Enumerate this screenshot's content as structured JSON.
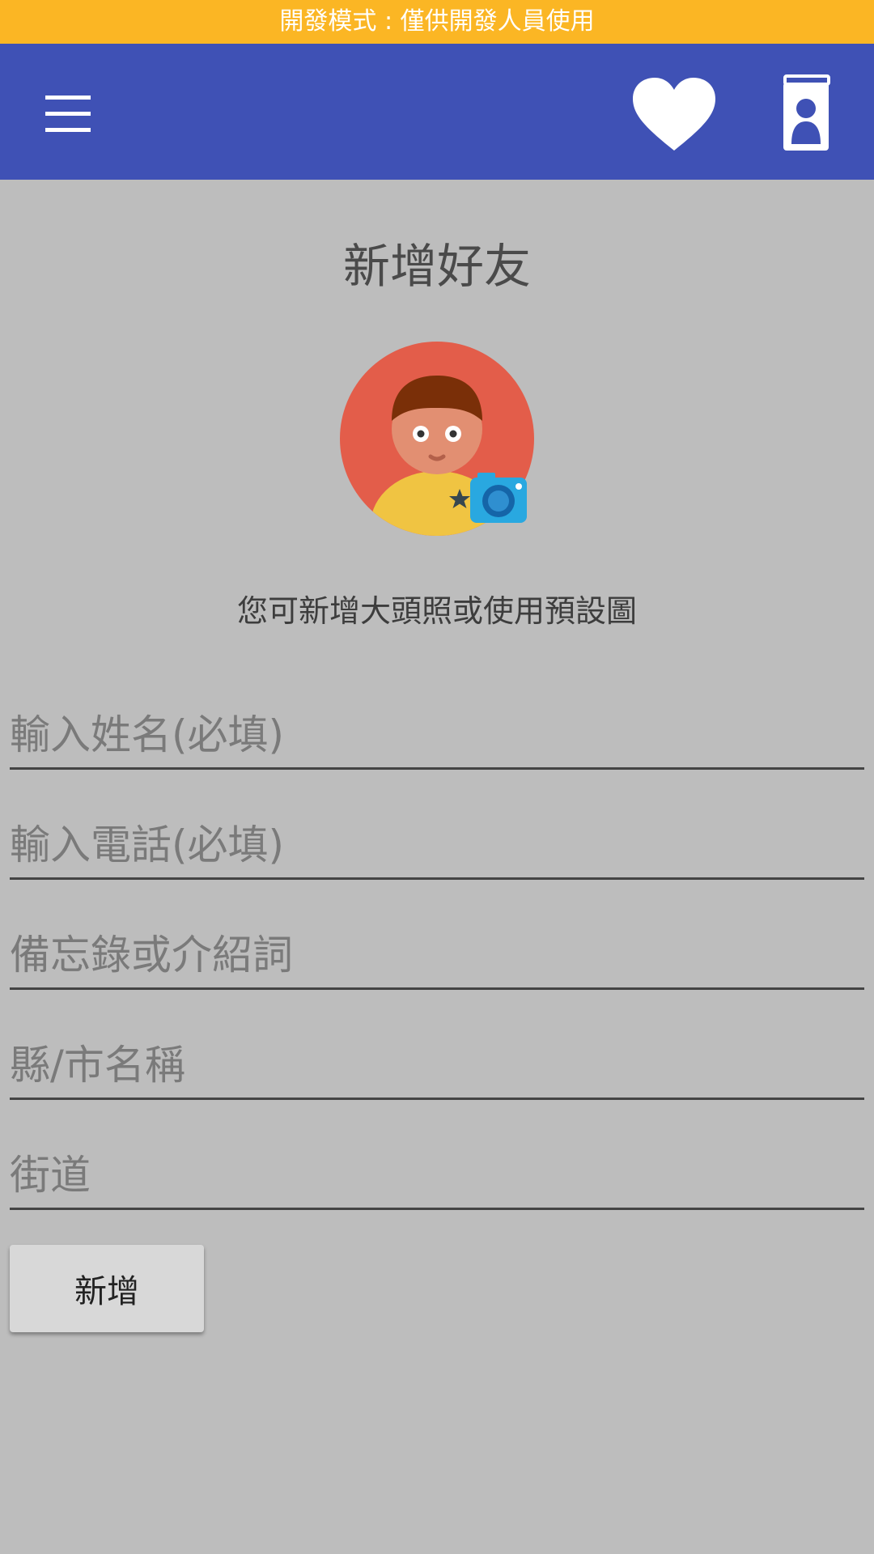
{
  "dev_banner": "開發模式 : 僅供開發人員使用",
  "app_bar": {
    "color": "#3f51b5",
    "icons": [
      "menu-icon",
      "heart-icon",
      "contacts-book-icon"
    ]
  },
  "form": {
    "title": "新增好友",
    "avatar_icon": "default-avatar-with-camera-icon",
    "avatar_hint": "您可新增大頭照或使用預設圖",
    "fields": {
      "name": {
        "value": "",
        "placeholder": "輸入姓名(必填)"
      },
      "phone": {
        "value": "",
        "placeholder": "輸入電話(必填)"
      },
      "memo": {
        "value": "",
        "placeholder": "備忘錄或介紹詞"
      },
      "city": {
        "value": "",
        "placeholder": "縣/市名稱"
      },
      "street": {
        "value": "",
        "placeholder": "街道"
      }
    },
    "submit_label": "新增"
  },
  "colors": {
    "dev_banner": "#fbb624",
    "background": "#bdbdbd",
    "accent": "#3f51b5"
  }
}
